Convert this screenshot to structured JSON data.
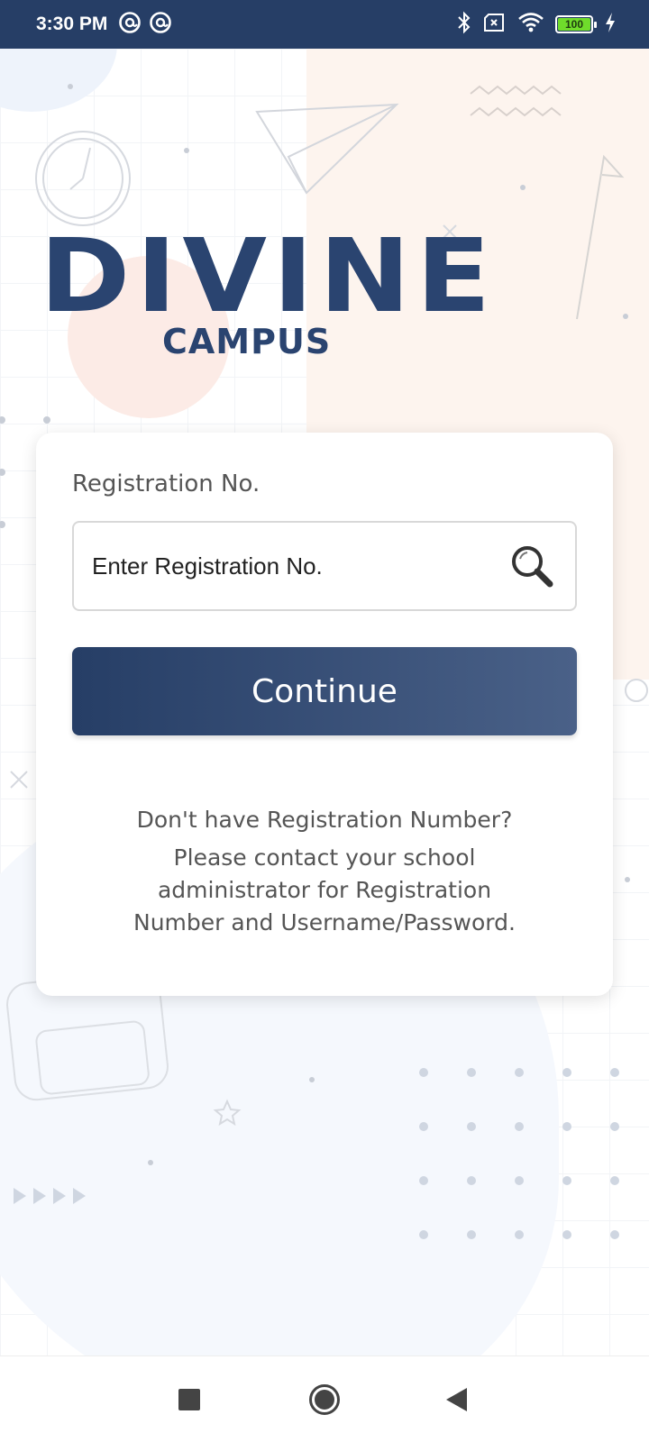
{
  "status_bar": {
    "time": "3:30 PM",
    "battery_level": "100",
    "icons": [
      "at-icon",
      "at-icon",
      "bluetooth-icon",
      "no-sim-icon",
      "wifi-icon",
      "battery-icon",
      "charging-icon"
    ]
  },
  "logo": {
    "main": "DIVINE",
    "sub": "CAMPUS"
  },
  "form": {
    "label": "Registration No.",
    "placeholder": "Enter Registration No.",
    "continue_label": "Continue"
  },
  "help": {
    "line1": "Don't have Registration Number?",
    "line2": "Please contact your school",
    "line3": "administrator for Registration",
    "line4": "Number and Username/Password."
  },
  "colors": {
    "brand": "#263e66",
    "accent_green": "#6fdc2b"
  }
}
